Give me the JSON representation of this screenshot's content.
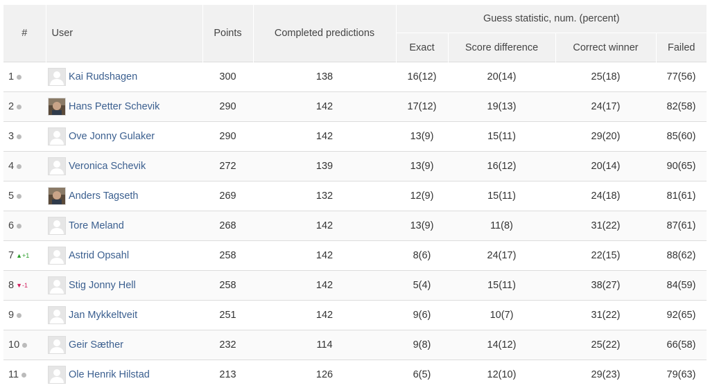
{
  "headers": {
    "rank": "#",
    "user": "User",
    "points": "Points",
    "completed": "Completed predictions",
    "guess_group": "Guess statistic, num. (percent)",
    "exact": "Exact",
    "score_difference": "Score difference",
    "correct_winner": "Correct winner",
    "failed": "Failed"
  },
  "rows": [
    {
      "rank": "1",
      "trend": "same",
      "change": "",
      "avatar": "placeholder",
      "name": "Kai Rudshagen",
      "points": "300",
      "completed": "138",
      "exact": "16(12)",
      "score_difference": "20(14)",
      "correct_winner": "25(18)",
      "failed": "77(56)"
    },
    {
      "rank": "2",
      "trend": "same",
      "change": "",
      "avatar": "photo",
      "name": "Hans Petter Schevik",
      "points": "290",
      "completed": "142",
      "exact": "17(12)",
      "score_difference": "19(13)",
      "correct_winner": "24(17)",
      "failed": "82(58)"
    },
    {
      "rank": "3",
      "trend": "same",
      "change": "",
      "avatar": "placeholder",
      "name": "Ove Jonny Gulaker",
      "points": "290",
      "completed": "142",
      "exact": "13(9)",
      "score_difference": "15(11)",
      "correct_winner": "29(20)",
      "failed": "85(60)"
    },
    {
      "rank": "4",
      "trend": "same",
      "change": "",
      "avatar": "placeholder",
      "name": "Veronica Schevik",
      "points": "272",
      "completed": "139",
      "exact": "13(9)",
      "score_difference": "16(12)",
      "correct_winner": "20(14)",
      "failed": "90(65)"
    },
    {
      "rank": "5",
      "trend": "same",
      "change": "",
      "avatar": "photo",
      "name": "Anders Tagseth",
      "points": "269",
      "completed": "132",
      "exact": "12(9)",
      "score_difference": "15(11)",
      "correct_winner": "24(18)",
      "failed": "81(61)"
    },
    {
      "rank": "6",
      "trend": "same",
      "change": "",
      "avatar": "placeholder",
      "name": "Tore Meland",
      "points": "268",
      "completed": "142",
      "exact": "13(9)",
      "score_difference": "11(8)",
      "correct_winner": "31(22)",
      "failed": "87(61)"
    },
    {
      "rank": "7",
      "trend": "up",
      "change": "+1",
      "avatar": "placeholder",
      "name": "Astrid Opsahl",
      "points": "258",
      "completed": "142",
      "exact": "8(6)",
      "score_difference": "24(17)",
      "correct_winner": "22(15)",
      "failed": "88(62)"
    },
    {
      "rank": "8",
      "trend": "down",
      "change": "-1",
      "avatar": "placeholder",
      "name": "Stig Jonny Hell",
      "points": "258",
      "completed": "142",
      "exact": "5(4)",
      "score_difference": "15(11)",
      "correct_winner": "38(27)",
      "failed": "84(59)"
    },
    {
      "rank": "9",
      "trend": "same",
      "change": "",
      "avatar": "placeholder",
      "name": "Jan Mykkeltveit",
      "points": "251",
      "completed": "142",
      "exact": "9(6)",
      "score_difference": "10(7)",
      "correct_winner": "31(22)",
      "failed": "92(65)"
    },
    {
      "rank": "10",
      "trend": "same",
      "change": "",
      "avatar": "placeholder",
      "name": "Geir Sæther",
      "points": "232",
      "completed": "114",
      "exact": "9(8)",
      "score_difference": "14(12)",
      "correct_winner": "25(22)",
      "failed": "66(58)"
    },
    {
      "rank": "11",
      "trend": "same",
      "change": "",
      "avatar": "placeholder",
      "name": "Ole Henrik Hilstad",
      "points": "213",
      "completed": "126",
      "exact": "6(5)",
      "score_difference": "12(10)",
      "correct_winner": "29(23)",
      "failed": "79(63)"
    }
  ],
  "colors": {
    "link": "#3b5f8f",
    "up": "#2a9d2a",
    "down": "#d21f5e",
    "header_bg": "#f1f1f1",
    "row_alt_bg": "#fafafa"
  }
}
